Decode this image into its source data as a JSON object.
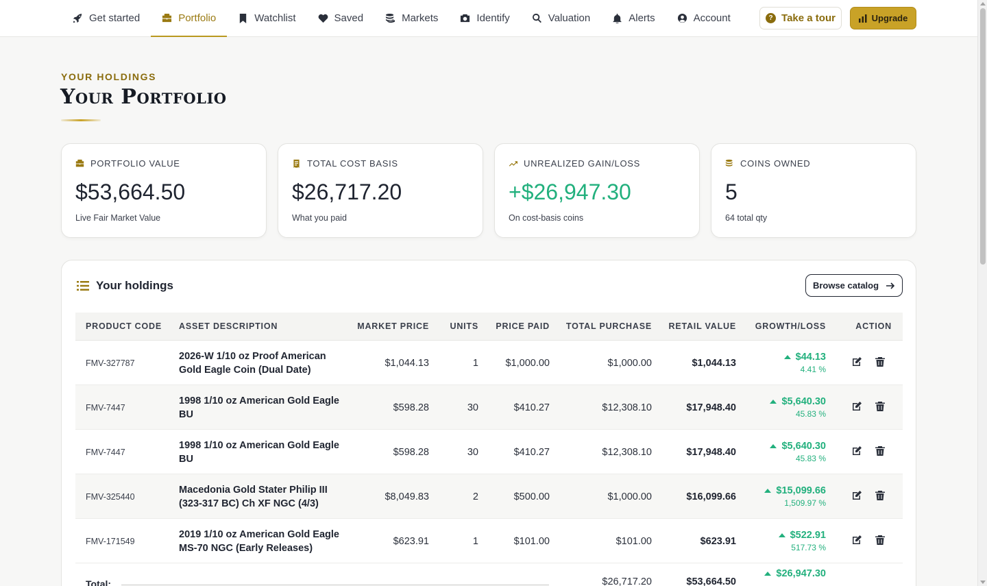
{
  "nav": {
    "items": [
      {
        "label": "Get started",
        "icon": "rocket-icon"
      },
      {
        "label": "Portfolio",
        "icon": "briefcase-icon",
        "active": true
      },
      {
        "label": "Watchlist",
        "icon": "bookmark-icon"
      },
      {
        "label": "Saved",
        "icon": "heart-icon"
      },
      {
        "label": "Markets",
        "icon": "coins-icon"
      },
      {
        "label": "Identify",
        "icon": "camera-icon"
      },
      {
        "label": "Valuation",
        "icon": "search-icon"
      },
      {
        "label": "Alerts",
        "icon": "bell-icon"
      },
      {
        "label": "Account",
        "icon": "user-circle-icon"
      }
    ],
    "tour_label": "Take a tour",
    "upgrade_label": "Upgrade"
  },
  "header": {
    "eyebrow": "YOUR HOLDINGS",
    "title": "Your Portfolio"
  },
  "stats": [
    {
      "label": "PORTFOLIO VALUE",
      "value": "$53,664.50",
      "sub": "Live Fair Market Value",
      "icon": "briefcase-icon"
    },
    {
      "label": "TOTAL COST BASIS",
      "value": "$26,717.20",
      "sub": "What you paid",
      "icon": "receipt-icon"
    },
    {
      "label": "UNREALIZED GAIN/LOSS",
      "value": "+$26,947.30",
      "sub": "On cost-basis coins",
      "icon": "trend-up-icon"
    },
    {
      "label": "COINS OWNED",
      "value": "5",
      "sub": "64 total qty",
      "icon": "coins-icon"
    }
  ],
  "holdings": {
    "title": "Your holdings",
    "browse_label": "Browse catalog",
    "columns": [
      "PRODUCT CODE",
      "ASSET DESCRIPTION",
      "MARKET PRICE",
      "UNITS",
      "PRICE PAID",
      "TOTAL PURCHASE",
      "RETAIL VALUE",
      "GROWTH/LOSS",
      "ACTION"
    ],
    "rows": [
      {
        "code": "FMV-327787",
        "desc1": "2026-W 1/10 oz Proof American",
        "desc2": "Gold Eagle Coin (Dual Date)",
        "market": "$1,044.13",
        "units": "1",
        "paid": "$1,000.00",
        "total": "$1,000.00",
        "retail": "$1,044.13",
        "growth": "$44.13",
        "pct": "4.41 %"
      },
      {
        "code": "FMV-7447",
        "desc1": "1998 1/10 oz American Gold Eagle",
        "desc2": "BU",
        "market": "$598.28",
        "units": "30",
        "paid": "$410.27",
        "total": "$12,308.10",
        "retail": "$17,948.40",
        "growth": "$5,640.30",
        "pct": "45.83 %"
      },
      {
        "code": "FMV-7447",
        "desc1": "1998 1/10 oz American Gold Eagle",
        "desc2": "BU",
        "market": "$598.28",
        "units": "30",
        "paid": "$410.27",
        "total": "$12,308.10",
        "retail": "$17,948.40",
        "growth": "$5,640.30",
        "pct": "45.83 %"
      },
      {
        "code": "FMV-325440",
        "desc1": "Macedonia Gold Stater Philip III",
        "desc2": "(323-317 BC) Ch XF NGC (4/3)",
        "market": "$8,049.83",
        "units": "2",
        "paid": "$500.00",
        "total": "$1,000.00",
        "retail": "$16,099.66",
        "growth": "$15,099.66",
        "pct": "1,509.97 %"
      },
      {
        "code": "FMV-171549",
        "desc1": "2019 1/10 oz American Gold Eagle",
        "desc2": "MS-70 NGC (Early Releases)",
        "market": "$623.91",
        "units": "1",
        "paid": "$101.00",
        "total": "$101.00",
        "retail": "$623.91",
        "growth": "$522.91",
        "pct": "517.73 %"
      }
    ],
    "totals": {
      "label": "Total:",
      "purchase": "$26,717.20",
      "retail": "$53,664.50",
      "growth": "$26,947.30"
    }
  },
  "colors": {
    "gold": "#c9a227",
    "gold_dark": "#9a7a12",
    "gain": "#22b07d"
  }
}
